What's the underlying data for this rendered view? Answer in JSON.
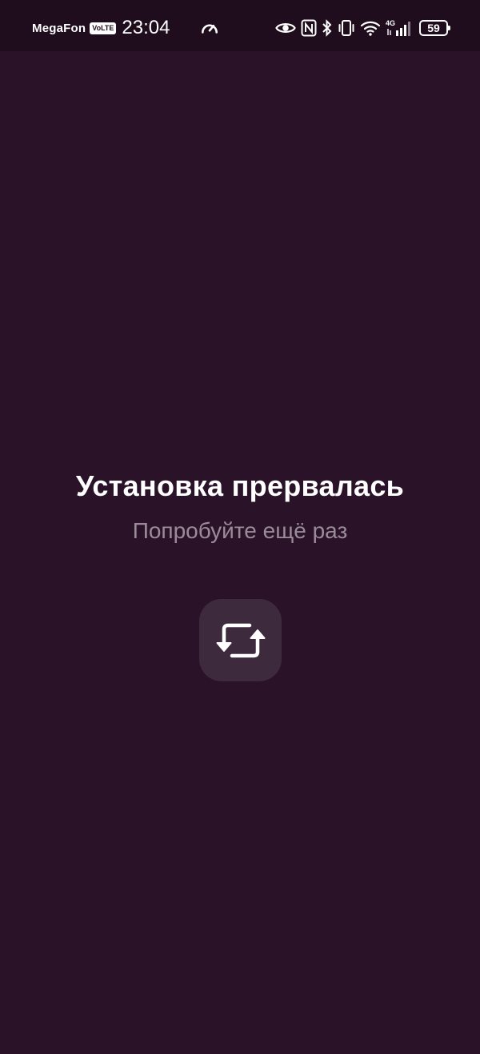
{
  "status_bar": {
    "carrier": "MegaFon",
    "volte": "VoLTE",
    "time": "23:04",
    "network_type": "4G",
    "battery": "59",
    "icons": [
      "speed-icon",
      "eye-icon",
      "nfc-icon",
      "bluetooth-icon",
      "vibrate-icon",
      "wifi-icon",
      "signal-icon",
      "battery-icon"
    ]
  },
  "main": {
    "title": "Установка прервалась",
    "subtitle": "Попробуйте ещё раз",
    "retry_icon": "refresh-icon"
  },
  "colors": {
    "background": "#2a1329",
    "status_bar": "#1f0d1e",
    "button": "#3e2a3d",
    "subtitle": "#9a8b99",
    "text": "#ffffff"
  }
}
